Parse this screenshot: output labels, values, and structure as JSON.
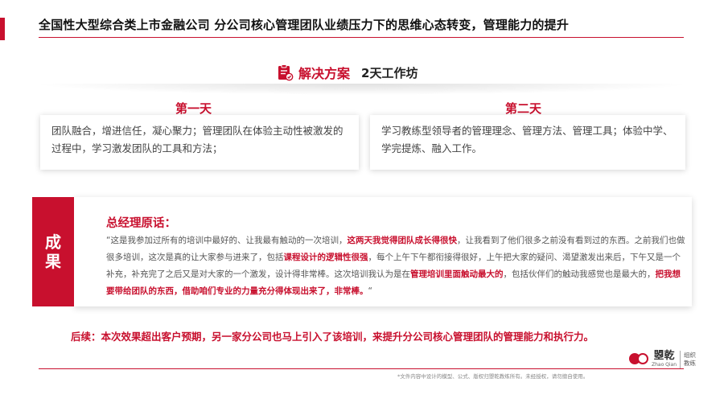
{
  "header": {
    "title": "全国性大型综合类上市金融公司 分公司核心管理团队业绩压力下的思维心态转变，管理能力的提升"
  },
  "solution": {
    "icon": "clipboard-check-icon",
    "title": "解决方案",
    "subtitle": "2天工作坊"
  },
  "days": [
    {
      "title": "第一天",
      "text": "团队融合，增进信任，凝心聚力；管理团队在体验主动性被激发的过程中，学习激发团队的工具和方法；"
    },
    {
      "title": "第二天",
      "text": "学习教练型领导者的管理理念、管理方法、管理工具；体验中学、学完提炼、融入工作。"
    }
  ],
  "result": {
    "tab_line1": "成",
    "tab_line2": "果",
    "quote_title": "总经理原话：",
    "q1": "“这是我参加过所有的培训中最好的、让我最有触动的一次培训，",
    "q2": "这两天我觉得团队成长得很快",
    "q3": "，让我看到了他们很多之前没有看到过的东西。之前我们也做很多培训，这次是真的让大家参与进来了，包括",
    "q4": "课程设计的逻辑性很强",
    "q5": "，每个上午下午都衔接得很好，上午把大家的疑问、渴望激发出来后，下午又是一个补充，补充完了之后又是对大家的一个激发，设计得非常棒。这次培训我认为是在",
    "q6": "管理培训里面触动最大的",
    "q7": "，包括伙伴们的触动我感觉也是最大的，",
    "q8": "把我想要带给团队的东西，借助咱们专业的力量充分得体现出来了，非常棒。",
    "q9": "“"
  },
  "follow_up": "后续：本次效果超出客户预期，另一家分公司也马上引入了该培训，来提升分公司核心管理团队的管理能力和执行力。",
  "logo": {
    "cn": "曌乾",
    "en": "Zhao Qian",
    "tag_line1": "组织",
    "tag_line2": "教练"
  },
  "footnote": "*文件内容中设计的模型、公式、版权归曌乾教练所有。未经授权，请勿擅自使用。",
  "colors": {
    "accent": "#c8102e"
  }
}
